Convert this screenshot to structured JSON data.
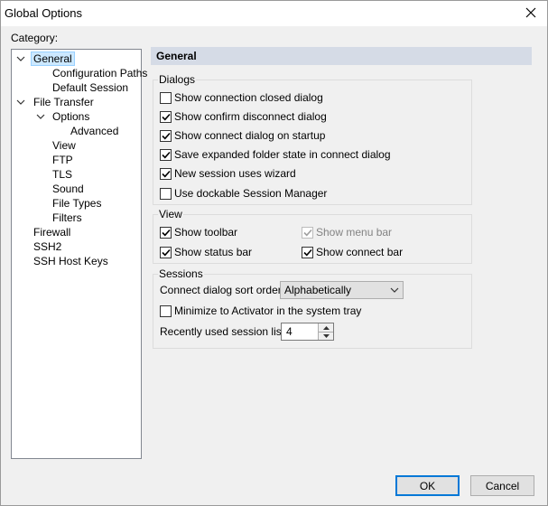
{
  "window": {
    "title": "Global Options"
  },
  "category_label": "Category:",
  "tree": {
    "general": "General",
    "configuration_paths": "Configuration Paths",
    "default_session": "Default Session",
    "file_transfer": "File Transfer",
    "options": "Options",
    "advanced": "Advanced",
    "view": "View",
    "ftp": "FTP",
    "tls": "TLS",
    "sound": "Sound",
    "file_types": "File Types",
    "filters": "Filters",
    "firewall": "Firewall",
    "ssh2": "SSH2",
    "ssh_host_keys": "SSH Host Keys"
  },
  "panel": {
    "title": "General"
  },
  "dialogs": {
    "title": "Dialogs",
    "show_connection_closed": {
      "label": "Show connection closed dialog",
      "checked": false
    },
    "show_confirm_disconnect": {
      "label": "Show confirm disconnect dialog",
      "checked": true
    },
    "show_connect_on_startup": {
      "label": "Show connect dialog on startup",
      "checked": true
    },
    "save_expanded_folder": {
      "label": "Save expanded folder state in connect dialog",
      "checked": true
    },
    "new_session_wizard": {
      "label": "New session uses wizard",
      "checked": true
    },
    "dockable_session_manager": {
      "label": "Use dockable Session Manager",
      "checked": false
    }
  },
  "view": {
    "title": "View",
    "show_toolbar": {
      "label": "Show toolbar",
      "checked": true
    },
    "show_menu_bar": {
      "label": "Show menu bar",
      "checked": true,
      "disabled": true
    },
    "show_status_bar": {
      "label": "Show status bar",
      "checked": true
    },
    "show_connect_bar": {
      "label": "Show connect bar",
      "checked": true
    }
  },
  "sessions": {
    "title": "Sessions",
    "sort_order_label": "Connect dialog sort order:",
    "sort_order_value": "Alphabetically",
    "minimize_to_tray": {
      "label": "Minimize to Activator in the system tray",
      "checked": false
    },
    "recent_list_label": "Recently used session list:",
    "recent_list_value": "4"
  },
  "buttons": {
    "ok": "OK",
    "cancel": "Cancel"
  },
  "colors": {
    "selection": "#cce8ff",
    "header": "#d5dbe6",
    "default_button_border": "#0078d7"
  }
}
